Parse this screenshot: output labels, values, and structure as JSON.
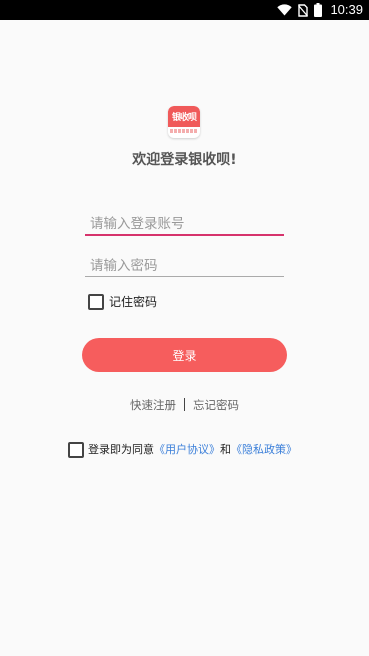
{
  "status_bar": {
    "time": "10:39",
    "icons": [
      "wifi-icon",
      "no-sim-icon",
      "battery-icon"
    ]
  },
  "logo": {
    "text": "银收呗"
  },
  "welcome_text": "欢迎登录银收呗!",
  "form": {
    "account_placeholder": "请输入登录账号",
    "password_placeholder": "请输入密码",
    "remember_label": "记住密码",
    "remember_checked": false
  },
  "login_button_label": "登录",
  "links": {
    "register": "快速注册",
    "forgot": "忘记密码"
  },
  "agreement": {
    "prefix": "登录即为同意",
    "user_agreement": "《用户协议》",
    "and": "和",
    "privacy_policy": "《隐私政策》",
    "checked": false
  },
  "colors": {
    "accent": "#f65d5d",
    "focus_underline": "#d6336c",
    "link": "#3b7fd9",
    "background": "#fafafa"
  }
}
